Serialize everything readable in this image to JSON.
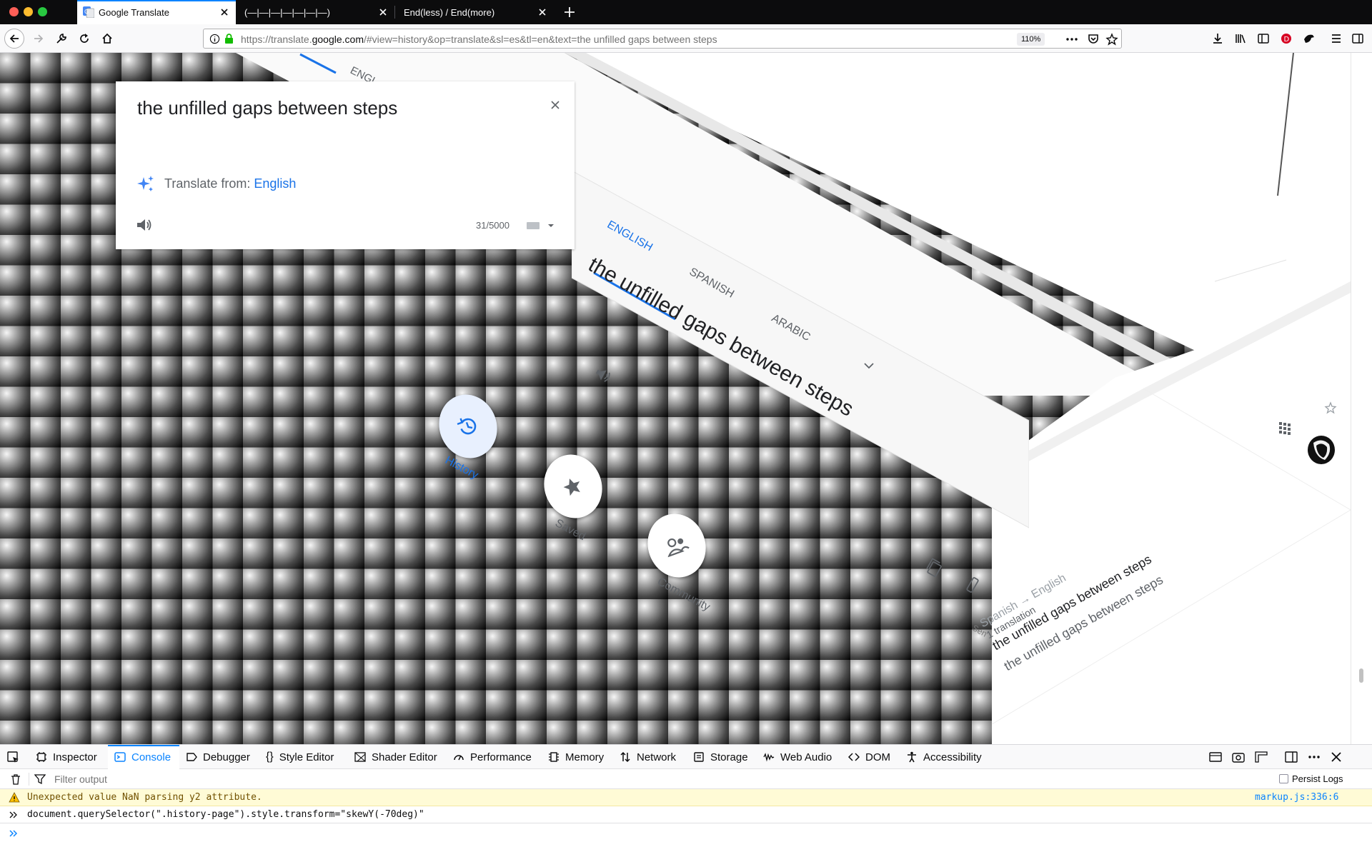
{
  "browser": {
    "tabs": [
      {
        "title": "Google Translate",
        "active": true
      },
      {
        "title": "(—|—|—|—|—|—|—)",
        "active": false
      },
      {
        "title": "End(less) / End(more)",
        "active": false
      }
    ],
    "url_prefix": "https://translate.",
    "url_host": "google.com",
    "url_rest": "/#view=history&op=translate&sl=es&tl=en&text=the unfilled gaps between steps",
    "zoom": "110%",
    "colors": {
      "titlebar": "#0c0c0d",
      "accent": "#0a84ff",
      "google_blue": "#1a73e8"
    }
  },
  "translate": {
    "source_text": "the unfilled gaps between steps",
    "detect_prefix": "Translate from:",
    "detect_language": "English",
    "char_count": "31/5000",
    "skewed_panel": {
      "tabs": [
        "ENGLISH",
        "SPANISH",
        "ARABIC"
      ],
      "top_tab": "ENGL",
      "text": "the unfilled gaps between steps"
    },
    "nav_buttons": [
      {
        "label": "History",
        "icon": "history-icon"
      },
      {
        "label": "Saved",
        "icon": "star-icon"
      },
      {
        "label": "Community",
        "icon": "people-icon"
      }
    ],
    "history": {
      "lang_pair": "Spanish → English",
      "count": "1 translation",
      "source": "the unfilled gaps between steps",
      "target": "the unfilled gaps between steps",
      "send_label": "Sen"
    }
  },
  "devtools": {
    "tabs": [
      "Inspector",
      "Console",
      "Debugger",
      "Style Editor",
      "Shader Editor",
      "Performance",
      "Memory",
      "Network",
      "Storage",
      "Web Audio",
      "DOM",
      "Accessibility"
    ],
    "selected_tab": "Console",
    "filter_placeholder": "Filter output",
    "persist_logs": "Persist Logs",
    "warning": {
      "message": "Unexpected value NaN parsing y2 attribute.",
      "source": "markup.js:336:6"
    },
    "command": "document.querySelector(\".history-page\").style.transform=\"skewY(-70deg)\""
  }
}
